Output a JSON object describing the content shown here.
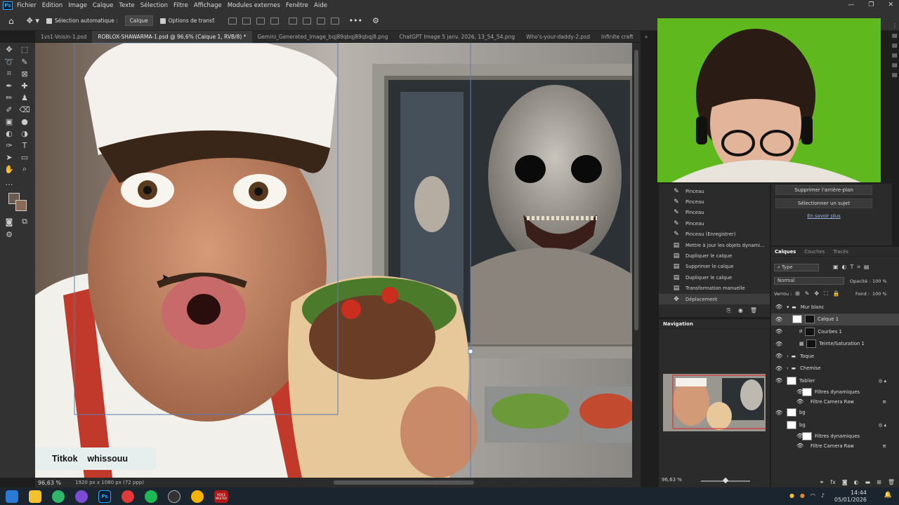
{
  "menu": {
    "items": [
      "Fichier",
      "Edition",
      "Image",
      "Calque",
      "Texte",
      "Sélection",
      "Filtre",
      "Affichage",
      "Modules externes",
      "Fenêtre",
      "Aide"
    ]
  },
  "options_bar": {
    "auto_select_label": "Sélection automatique :",
    "auto_select_value": "Calque",
    "transform_label": "Options de transf."
  },
  "tabs": [
    {
      "label": "1vs1-Voisin-1.psd",
      "active": false
    },
    {
      "label": "ROBLOX-SHAWARMA-1.psd @ 96,6% (Calque 1, RVB/8) *",
      "active": true
    },
    {
      "label": "Gemini_Generated_Image_bqj89qbqj89qbqj8.png",
      "active": false
    },
    {
      "label": "ChatGPT Image 5 janv. 2026, 13_54_54.png",
      "active": false
    },
    {
      "label": "Who's-your-daddy-2.psd",
      "active": false
    },
    {
      "label": "Infinite craft",
      "active": false
    }
  ],
  "status": {
    "zoom": "96,63 %",
    "doc_size": "1920 px x 1080 px (72 ppp)"
  },
  "canvas": {
    "caption": "Titkok    whissouu"
  },
  "history": {
    "items": [
      "Pinceau",
      "Pinceau",
      "Pinceau",
      "Pinceau",
      "Pinceau (Enregistrer)",
      "Mettre à jour les objets dynami...",
      "Dupliquer le calque",
      "Supprimer le calque",
      "Dupliquer le calque",
      "Transformation manuelle",
      "Déplacement"
    ]
  },
  "properties": {
    "remove_bg": "Supprimer l'arrière-plan",
    "select_subject": "Sélectionner un sujet",
    "learn_more": "En savoir plus"
  },
  "layers_panel": {
    "tabs": [
      "Calques",
      "Couches",
      "Tracés"
    ],
    "filter": "Type",
    "blend_mode": "Normal",
    "opacity_label": "Opacité :",
    "opacity_value": "100 %",
    "lock_label": "Verrou :",
    "fill_label": "Fond :",
    "fill_value": "100 %",
    "layers": [
      {
        "name": "Mur blanc",
        "kind": "group"
      },
      {
        "name": "Calque 1",
        "kind": "layer"
      },
      {
        "name": "Courbes 1",
        "kind": "adjustment"
      },
      {
        "name": "Teinte/Saturation 1",
        "kind": "adjustment"
      },
      {
        "name": "Toque",
        "kind": "group"
      },
      {
        "name": "Chemise",
        "kind": "group"
      },
      {
        "name": "Tablier",
        "kind": "smart"
      },
      {
        "name": "Filtres dynamiques",
        "kind": "filter"
      },
      {
        "name": "Filtre Camera Raw",
        "kind": "filter-item"
      },
      {
        "name": "bg",
        "kind": "smart"
      },
      {
        "name": "bg",
        "kind": "smart"
      },
      {
        "name": "Filtres dynamiques",
        "kind": "filter"
      },
      {
        "name": "Filtre Camera Raw",
        "kind": "filter-item"
      }
    ]
  },
  "navigator": {
    "title": "Navigation",
    "zoom": "96,63 %"
  },
  "taskbar": {
    "time": "14:44",
    "date": "05/01/2026",
    "voice_label": "VOICE MEETER"
  },
  "colors": {
    "ps_blue": "#31a8ff",
    "green_screen": "#5fb81d"
  }
}
